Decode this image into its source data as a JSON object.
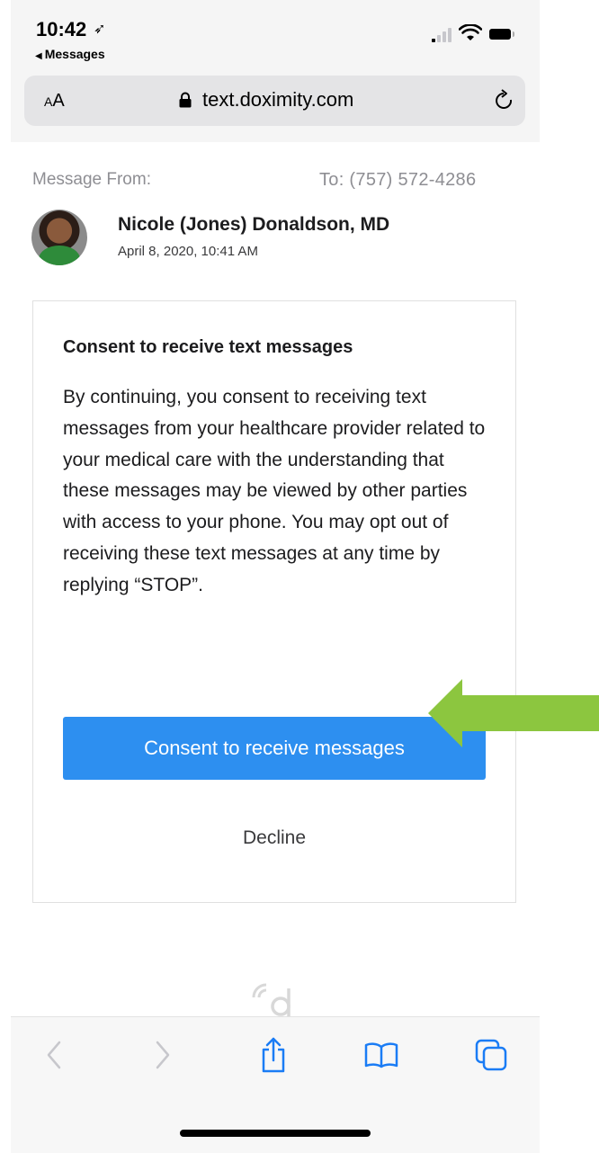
{
  "status_bar": {
    "time": "10:42",
    "back_app": "Messages",
    "cellular_bars_active": 1
  },
  "browser": {
    "text_size_label_small": "A",
    "text_size_label_large": "A",
    "url": "text.doximity.com"
  },
  "message": {
    "from_label": "Message From:",
    "to_label": "To: (757) 572-4286",
    "sender_name": "Nicole (Jones) Donaldson, MD",
    "sent_at": "April 8, 2020, 10:41 AM"
  },
  "consent": {
    "title": "Consent to receive text messages",
    "body": "By continuing, you consent to receiving text messages from your healthcare provider related to your medical care with the understanding that these messages may be viewed by other parties with access to your phone. You may opt out of receiving these text messages at any time by replying “STOP”.",
    "accept_label": "Consent to receive messages",
    "decline_label": "Decline"
  },
  "colors": {
    "accent_button": "#2d8ff0",
    "annotation_arrow": "#8cc63f",
    "toolbar_icon_active": "#1a7cf5",
    "toolbar_icon_disabled": "#c7c7cc"
  },
  "toolbar": {
    "icons": [
      "back-icon",
      "forward-icon",
      "share-icon",
      "bookmarks-icon",
      "tabs-icon"
    ]
  }
}
